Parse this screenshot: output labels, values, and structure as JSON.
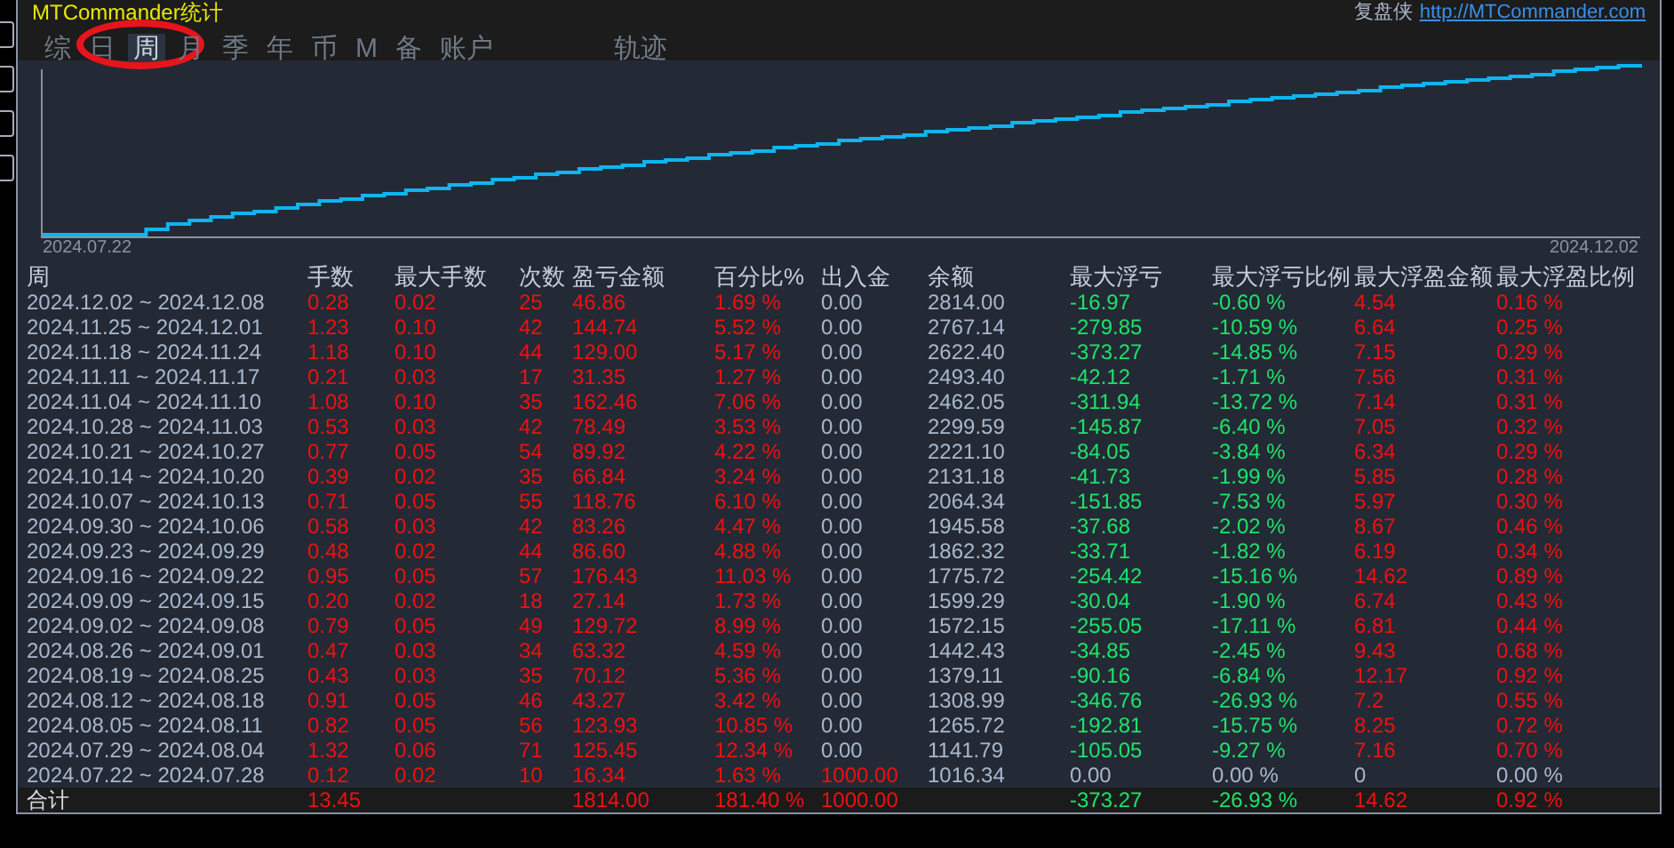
{
  "window": {
    "title": "MTCommander统计",
    "brand": "复盘侠",
    "link": "http://MTCommander.com"
  },
  "tabs": [
    {
      "label": "综",
      "selected": false,
      "separated": false
    },
    {
      "label": "日",
      "selected": false,
      "separated": false
    },
    {
      "label": "周",
      "selected": true,
      "separated": false
    },
    {
      "label": "月",
      "selected": false,
      "separated": false
    },
    {
      "label": "季",
      "selected": false,
      "separated": false
    },
    {
      "label": "年",
      "selected": false,
      "separated": false
    },
    {
      "label": "币",
      "selected": false,
      "separated": false
    },
    {
      "label": "M",
      "selected": false,
      "separated": false
    },
    {
      "label": "备",
      "selected": false,
      "separated": false
    },
    {
      "label": "账户",
      "selected": false,
      "separated": false
    },
    {
      "label": "轨迹",
      "selected": false,
      "separated": true
    }
  ],
  "chart": {
    "start_label": "2024.07.22",
    "end_label": "2024.12.02"
  },
  "table": {
    "columns": [
      "周",
      "手数",
      "最大手数",
      "次数",
      "盈亏金额",
      "百分比%",
      "出入金",
      "余额",
      "最大浮亏",
      "最大浮亏比例",
      "最大浮盈金额",
      "最大浮盈比例"
    ],
    "rows": [
      {
        "cells": [
          {
            "text": "2024.12.02 ~ 2024.12.08",
            "color": "#aab8cc"
          },
          {
            "text": "0.28",
            "color": "#ee1111"
          },
          {
            "text": "0.02",
            "color": "#ee1111"
          },
          {
            "text": "25",
            "color": "#ee1111"
          },
          {
            "text": "46.86",
            "color": "#ee1111"
          },
          {
            "text": "1.69 %",
            "color": "#ee1111"
          },
          {
            "text": "0.00",
            "color": "#aab8cc"
          },
          {
            "text": "2814.00",
            "color": "#aab8cc"
          },
          {
            "text": "-16.97",
            "color": "#1ee36a"
          },
          {
            "text": "-0.60 %",
            "color": "#1ee36a"
          },
          {
            "text": "4.54",
            "color": "#ee1111"
          },
          {
            "text": "0.16 %",
            "color": "#ee1111"
          }
        ]
      },
      {
        "cells": [
          {
            "text": "2024.11.25 ~ 2024.12.01",
            "color": "#aab8cc"
          },
          {
            "text": "1.23",
            "color": "#ee1111"
          },
          {
            "text": "0.10",
            "color": "#ee1111"
          },
          {
            "text": "42",
            "color": "#ee1111"
          },
          {
            "text": "144.74",
            "color": "#ee1111"
          },
          {
            "text": "5.52 %",
            "color": "#ee1111"
          },
          {
            "text": "0.00",
            "color": "#aab8cc"
          },
          {
            "text": "2767.14",
            "color": "#aab8cc"
          },
          {
            "text": "-279.85",
            "color": "#1ee36a"
          },
          {
            "text": "-10.59 %",
            "color": "#1ee36a"
          },
          {
            "text": "6.64",
            "color": "#ee1111"
          },
          {
            "text": "0.25 %",
            "color": "#ee1111"
          }
        ]
      },
      {
        "cells": [
          {
            "text": "2024.11.18 ~ 2024.11.24",
            "color": "#aab8cc"
          },
          {
            "text": "1.18",
            "color": "#ee1111"
          },
          {
            "text": "0.10",
            "color": "#ee1111"
          },
          {
            "text": "44",
            "color": "#ee1111"
          },
          {
            "text": "129.00",
            "color": "#ee1111"
          },
          {
            "text": "5.17 %",
            "color": "#ee1111"
          },
          {
            "text": "0.00",
            "color": "#aab8cc"
          },
          {
            "text": "2622.40",
            "color": "#aab8cc"
          },
          {
            "text": "-373.27",
            "color": "#1ee36a"
          },
          {
            "text": "-14.85 %",
            "color": "#1ee36a"
          },
          {
            "text": "7.15",
            "color": "#ee1111"
          },
          {
            "text": "0.29 %",
            "color": "#ee1111"
          }
        ]
      },
      {
        "cells": [
          {
            "text": "2024.11.11 ~ 2024.11.17",
            "color": "#aab8cc"
          },
          {
            "text": "0.21",
            "color": "#ee1111"
          },
          {
            "text": "0.03",
            "color": "#ee1111"
          },
          {
            "text": "17",
            "color": "#ee1111"
          },
          {
            "text": "31.35",
            "color": "#ee1111"
          },
          {
            "text": "1.27 %",
            "color": "#ee1111"
          },
          {
            "text": "0.00",
            "color": "#aab8cc"
          },
          {
            "text": "2493.40",
            "color": "#aab8cc"
          },
          {
            "text": "-42.12",
            "color": "#1ee36a"
          },
          {
            "text": "-1.71 %",
            "color": "#1ee36a"
          },
          {
            "text": "7.56",
            "color": "#ee1111"
          },
          {
            "text": "0.31 %",
            "color": "#ee1111"
          }
        ]
      },
      {
        "cells": [
          {
            "text": "2024.11.04 ~ 2024.11.10",
            "color": "#aab8cc"
          },
          {
            "text": "1.08",
            "color": "#ee1111"
          },
          {
            "text": "0.10",
            "color": "#ee1111"
          },
          {
            "text": "35",
            "color": "#ee1111"
          },
          {
            "text": "162.46",
            "color": "#ee1111"
          },
          {
            "text": "7.06 %",
            "color": "#ee1111"
          },
          {
            "text": "0.00",
            "color": "#aab8cc"
          },
          {
            "text": "2462.05",
            "color": "#aab8cc"
          },
          {
            "text": "-311.94",
            "color": "#1ee36a"
          },
          {
            "text": "-13.72 %",
            "color": "#1ee36a"
          },
          {
            "text": "7.14",
            "color": "#ee1111"
          },
          {
            "text": "0.31 %",
            "color": "#ee1111"
          }
        ]
      },
      {
        "cells": [
          {
            "text": "2024.10.28 ~ 2024.11.03",
            "color": "#aab8cc"
          },
          {
            "text": "0.53",
            "color": "#ee1111"
          },
          {
            "text": "0.03",
            "color": "#ee1111"
          },
          {
            "text": "42",
            "color": "#ee1111"
          },
          {
            "text": "78.49",
            "color": "#ee1111"
          },
          {
            "text": "3.53 %",
            "color": "#ee1111"
          },
          {
            "text": "0.00",
            "color": "#aab8cc"
          },
          {
            "text": "2299.59",
            "color": "#aab8cc"
          },
          {
            "text": "-145.87",
            "color": "#1ee36a"
          },
          {
            "text": "-6.40 %",
            "color": "#1ee36a"
          },
          {
            "text": "7.05",
            "color": "#ee1111"
          },
          {
            "text": "0.32 %",
            "color": "#ee1111"
          }
        ]
      },
      {
        "cells": [
          {
            "text": "2024.10.21 ~ 2024.10.27",
            "color": "#aab8cc"
          },
          {
            "text": "0.77",
            "color": "#ee1111"
          },
          {
            "text": "0.05",
            "color": "#ee1111"
          },
          {
            "text": "54",
            "color": "#ee1111"
          },
          {
            "text": "89.92",
            "color": "#ee1111"
          },
          {
            "text": "4.22 %",
            "color": "#ee1111"
          },
          {
            "text": "0.00",
            "color": "#aab8cc"
          },
          {
            "text": "2221.10",
            "color": "#aab8cc"
          },
          {
            "text": "-84.05",
            "color": "#1ee36a"
          },
          {
            "text": "-3.84 %",
            "color": "#1ee36a"
          },
          {
            "text": "6.34",
            "color": "#ee1111"
          },
          {
            "text": "0.29 %",
            "color": "#ee1111"
          }
        ]
      },
      {
        "cells": [
          {
            "text": "2024.10.14 ~ 2024.10.20",
            "color": "#aab8cc"
          },
          {
            "text": "0.39",
            "color": "#ee1111"
          },
          {
            "text": "0.02",
            "color": "#ee1111"
          },
          {
            "text": "35",
            "color": "#ee1111"
          },
          {
            "text": "66.84",
            "color": "#ee1111"
          },
          {
            "text": "3.24 %",
            "color": "#ee1111"
          },
          {
            "text": "0.00",
            "color": "#aab8cc"
          },
          {
            "text": "2131.18",
            "color": "#aab8cc"
          },
          {
            "text": "-41.73",
            "color": "#1ee36a"
          },
          {
            "text": "-1.99 %",
            "color": "#1ee36a"
          },
          {
            "text": "5.85",
            "color": "#ee1111"
          },
          {
            "text": "0.28 %",
            "color": "#ee1111"
          }
        ]
      },
      {
        "cells": [
          {
            "text": "2024.10.07 ~ 2024.10.13",
            "color": "#aab8cc"
          },
          {
            "text": "0.71",
            "color": "#ee1111"
          },
          {
            "text": "0.05",
            "color": "#ee1111"
          },
          {
            "text": "55",
            "color": "#ee1111"
          },
          {
            "text": "118.76",
            "color": "#ee1111"
          },
          {
            "text": "6.10 %",
            "color": "#ee1111"
          },
          {
            "text": "0.00",
            "color": "#aab8cc"
          },
          {
            "text": "2064.34",
            "color": "#aab8cc"
          },
          {
            "text": "-151.85",
            "color": "#1ee36a"
          },
          {
            "text": "-7.53 %",
            "color": "#1ee36a"
          },
          {
            "text": "5.97",
            "color": "#ee1111"
          },
          {
            "text": "0.30 %",
            "color": "#ee1111"
          }
        ]
      },
      {
        "cells": [
          {
            "text": "2024.09.30 ~ 2024.10.06",
            "color": "#aab8cc"
          },
          {
            "text": "0.58",
            "color": "#ee1111"
          },
          {
            "text": "0.03",
            "color": "#ee1111"
          },
          {
            "text": "42",
            "color": "#ee1111"
          },
          {
            "text": "83.26",
            "color": "#ee1111"
          },
          {
            "text": "4.47 %",
            "color": "#ee1111"
          },
          {
            "text": "0.00",
            "color": "#aab8cc"
          },
          {
            "text": "1945.58",
            "color": "#aab8cc"
          },
          {
            "text": "-37.68",
            "color": "#1ee36a"
          },
          {
            "text": "-2.02 %",
            "color": "#1ee36a"
          },
          {
            "text": "8.67",
            "color": "#ee1111"
          },
          {
            "text": "0.46 %",
            "color": "#ee1111"
          }
        ]
      },
      {
        "cells": [
          {
            "text": "2024.09.23 ~ 2024.09.29",
            "color": "#aab8cc"
          },
          {
            "text": "0.48",
            "color": "#ee1111"
          },
          {
            "text": "0.02",
            "color": "#ee1111"
          },
          {
            "text": "44",
            "color": "#ee1111"
          },
          {
            "text": "86.60",
            "color": "#ee1111"
          },
          {
            "text": "4.88 %",
            "color": "#ee1111"
          },
          {
            "text": "0.00",
            "color": "#aab8cc"
          },
          {
            "text": "1862.32",
            "color": "#aab8cc"
          },
          {
            "text": "-33.71",
            "color": "#1ee36a"
          },
          {
            "text": "-1.82 %",
            "color": "#1ee36a"
          },
          {
            "text": "6.19",
            "color": "#ee1111"
          },
          {
            "text": "0.34 %",
            "color": "#ee1111"
          }
        ]
      },
      {
        "cells": [
          {
            "text": "2024.09.16 ~ 2024.09.22",
            "color": "#aab8cc"
          },
          {
            "text": "0.95",
            "color": "#ee1111"
          },
          {
            "text": "0.05",
            "color": "#ee1111"
          },
          {
            "text": "57",
            "color": "#ee1111"
          },
          {
            "text": "176.43",
            "color": "#ee1111"
          },
          {
            "text": "11.03 %",
            "color": "#ee1111"
          },
          {
            "text": "0.00",
            "color": "#aab8cc"
          },
          {
            "text": "1775.72",
            "color": "#aab8cc"
          },
          {
            "text": "-254.42",
            "color": "#1ee36a"
          },
          {
            "text": "-15.16 %",
            "color": "#1ee36a"
          },
          {
            "text": "14.62",
            "color": "#ee1111"
          },
          {
            "text": "0.89 %",
            "color": "#ee1111"
          }
        ]
      },
      {
        "cells": [
          {
            "text": "2024.09.09 ~ 2024.09.15",
            "color": "#aab8cc"
          },
          {
            "text": "0.20",
            "color": "#ee1111"
          },
          {
            "text": "0.02",
            "color": "#ee1111"
          },
          {
            "text": "18",
            "color": "#ee1111"
          },
          {
            "text": "27.14",
            "color": "#ee1111"
          },
          {
            "text": "1.73 %",
            "color": "#ee1111"
          },
          {
            "text": "0.00",
            "color": "#aab8cc"
          },
          {
            "text": "1599.29",
            "color": "#aab8cc"
          },
          {
            "text": "-30.04",
            "color": "#1ee36a"
          },
          {
            "text": "-1.90 %",
            "color": "#1ee36a"
          },
          {
            "text": "6.74",
            "color": "#ee1111"
          },
          {
            "text": "0.43 %",
            "color": "#ee1111"
          }
        ]
      },
      {
        "cells": [
          {
            "text": "2024.09.02 ~ 2024.09.08",
            "color": "#aab8cc"
          },
          {
            "text": "0.79",
            "color": "#ee1111"
          },
          {
            "text": "0.05",
            "color": "#ee1111"
          },
          {
            "text": "49",
            "color": "#ee1111"
          },
          {
            "text": "129.72",
            "color": "#ee1111"
          },
          {
            "text": "8.99 %",
            "color": "#ee1111"
          },
          {
            "text": "0.00",
            "color": "#aab8cc"
          },
          {
            "text": "1572.15",
            "color": "#aab8cc"
          },
          {
            "text": "-255.05",
            "color": "#1ee36a"
          },
          {
            "text": "-17.11 %",
            "color": "#1ee36a"
          },
          {
            "text": "6.81",
            "color": "#ee1111"
          },
          {
            "text": "0.44 %",
            "color": "#ee1111"
          }
        ]
      },
      {
        "cells": [
          {
            "text": "2024.08.26 ~ 2024.09.01",
            "color": "#aab8cc"
          },
          {
            "text": "0.47",
            "color": "#ee1111"
          },
          {
            "text": "0.03",
            "color": "#ee1111"
          },
          {
            "text": "34",
            "color": "#ee1111"
          },
          {
            "text": "63.32",
            "color": "#ee1111"
          },
          {
            "text": "4.59 %",
            "color": "#ee1111"
          },
          {
            "text": "0.00",
            "color": "#aab8cc"
          },
          {
            "text": "1442.43",
            "color": "#aab8cc"
          },
          {
            "text": "-34.85",
            "color": "#1ee36a"
          },
          {
            "text": "-2.45 %",
            "color": "#1ee36a"
          },
          {
            "text": "9.43",
            "color": "#ee1111"
          },
          {
            "text": "0.68 %",
            "color": "#ee1111"
          }
        ]
      },
      {
        "cells": [
          {
            "text": "2024.08.19 ~ 2024.08.25",
            "color": "#aab8cc"
          },
          {
            "text": "0.43",
            "color": "#ee1111"
          },
          {
            "text": "0.03",
            "color": "#ee1111"
          },
          {
            "text": "35",
            "color": "#ee1111"
          },
          {
            "text": "70.12",
            "color": "#ee1111"
          },
          {
            "text": "5.36 %",
            "color": "#ee1111"
          },
          {
            "text": "0.00",
            "color": "#aab8cc"
          },
          {
            "text": "1379.11",
            "color": "#aab8cc"
          },
          {
            "text": "-90.16",
            "color": "#1ee36a"
          },
          {
            "text": "-6.84 %",
            "color": "#1ee36a"
          },
          {
            "text": "12.17",
            "color": "#ee1111"
          },
          {
            "text": "0.92 %",
            "color": "#ee1111"
          }
        ]
      },
      {
        "cells": [
          {
            "text": "2024.08.12 ~ 2024.08.18",
            "color": "#aab8cc"
          },
          {
            "text": "0.91",
            "color": "#ee1111"
          },
          {
            "text": "0.05",
            "color": "#ee1111"
          },
          {
            "text": "46",
            "color": "#ee1111"
          },
          {
            "text": "43.27",
            "color": "#ee1111"
          },
          {
            "text": "3.42 %",
            "color": "#ee1111"
          },
          {
            "text": "0.00",
            "color": "#aab8cc"
          },
          {
            "text": "1308.99",
            "color": "#aab8cc"
          },
          {
            "text": "-346.76",
            "color": "#1ee36a"
          },
          {
            "text": "-26.93 %",
            "color": "#1ee36a"
          },
          {
            "text": "7.2",
            "color": "#ee1111"
          },
          {
            "text": "0.55 %",
            "color": "#ee1111"
          }
        ]
      },
      {
        "cells": [
          {
            "text": "2024.08.05 ~ 2024.08.11",
            "color": "#aab8cc"
          },
          {
            "text": "0.82",
            "color": "#ee1111"
          },
          {
            "text": "0.05",
            "color": "#ee1111"
          },
          {
            "text": "56",
            "color": "#ee1111"
          },
          {
            "text": "123.93",
            "color": "#ee1111"
          },
          {
            "text": "10.85 %",
            "color": "#ee1111"
          },
          {
            "text": "0.00",
            "color": "#aab8cc"
          },
          {
            "text": "1265.72",
            "color": "#aab8cc"
          },
          {
            "text": "-192.81",
            "color": "#1ee36a"
          },
          {
            "text": "-15.75 %",
            "color": "#1ee36a"
          },
          {
            "text": "8.25",
            "color": "#ee1111"
          },
          {
            "text": "0.72 %",
            "color": "#ee1111"
          }
        ]
      },
      {
        "cells": [
          {
            "text": "2024.07.29 ~ 2024.08.04",
            "color": "#aab8cc"
          },
          {
            "text": "1.32",
            "color": "#ee1111"
          },
          {
            "text": "0.06",
            "color": "#ee1111"
          },
          {
            "text": "71",
            "color": "#ee1111"
          },
          {
            "text": "125.45",
            "color": "#ee1111"
          },
          {
            "text": "12.34 %",
            "color": "#ee1111"
          },
          {
            "text": "0.00",
            "color": "#aab8cc"
          },
          {
            "text": "1141.79",
            "color": "#aab8cc"
          },
          {
            "text": "-105.05",
            "color": "#1ee36a"
          },
          {
            "text": "-9.27 %",
            "color": "#1ee36a"
          },
          {
            "text": "7.16",
            "color": "#ee1111"
          },
          {
            "text": "0.70 %",
            "color": "#ee1111"
          }
        ]
      },
      {
        "cells": [
          {
            "text": "2024.07.22 ~ 2024.07.28",
            "color": "#aab8cc"
          },
          {
            "text": "0.12",
            "color": "#ee1111"
          },
          {
            "text": "0.02",
            "color": "#ee1111"
          },
          {
            "text": "10",
            "color": "#ee1111"
          },
          {
            "text": "16.34",
            "color": "#ee1111"
          },
          {
            "text": "1.63 %",
            "color": "#ee1111"
          },
          {
            "text": "1000.00",
            "color": "#ee1111"
          },
          {
            "text": "1016.34",
            "color": "#aab8cc"
          },
          {
            "text": "0.00",
            "color": "#aab8cc"
          },
          {
            "text": "0.00 %",
            "color": "#aab8cc"
          },
          {
            "text": "0",
            "color": "#aab8cc"
          },
          {
            "text": "0.00 %",
            "color": "#aab8cc"
          }
        ]
      }
    ],
    "total": {
      "cells": [
        {
          "text": "合计",
          "color": "#d7dbe2"
        },
        {
          "text": "13.45",
          "color": "#ee1111"
        },
        null,
        null,
        {
          "text": "1814.00",
          "color": "#ee1111"
        },
        {
          "text": "181.40 %",
          "color": "#ee1111"
        },
        {
          "text": "1000.00",
          "color": "#ee1111"
        },
        null,
        {
          "text": "-373.27",
          "color": "#1ee36a"
        },
        {
          "text": "-26.93 %",
          "color": "#1ee36a"
        },
        {
          "text": "14.62",
          "color": "#ee1111"
        },
        {
          "text": "0.92 %",
          "color": "#ee1111"
        }
      ]
    }
  }
}
